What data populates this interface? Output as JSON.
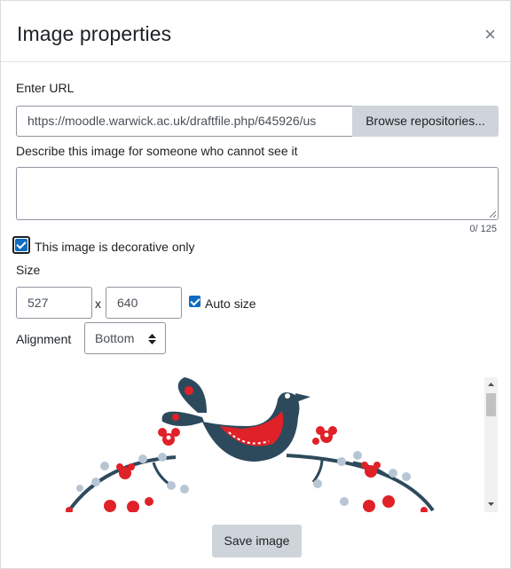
{
  "dialog": {
    "title": "Image properties",
    "close_glyph": "×"
  },
  "url": {
    "label": "Enter URL",
    "value": "https://moodle.warwick.ac.uk/draftfile.php/645926/us",
    "browse_label": "Browse repositories..."
  },
  "alt": {
    "label": "Describe this image for someone who cannot see it",
    "value": "",
    "counter": "0/ 125"
  },
  "decorative": {
    "label": "This image is decorative only",
    "checked": true
  },
  "size": {
    "label": "Size",
    "width": "527",
    "separator": "x",
    "height": "640",
    "auto_label": "Auto size",
    "auto_checked": true
  },
  "alignment": {
    "label": "Alignment",
    "selected": "Bottom"
  },
  "preview": {
    "icon": "folk-bird-illustration",
    "colors": {
      "navy": "#2d4a5c",
      "red": "#e02128",
      "light": "#b7c6d4"
    }
  },
  "save_label": "Save image",
  "icons": {
    "close": "close-icon",
    "select": "select-arrows-icon",
    "scroll_up": "scroll-up-icon",
    "scroll_down": "scroll-down-icon"
  }
}
